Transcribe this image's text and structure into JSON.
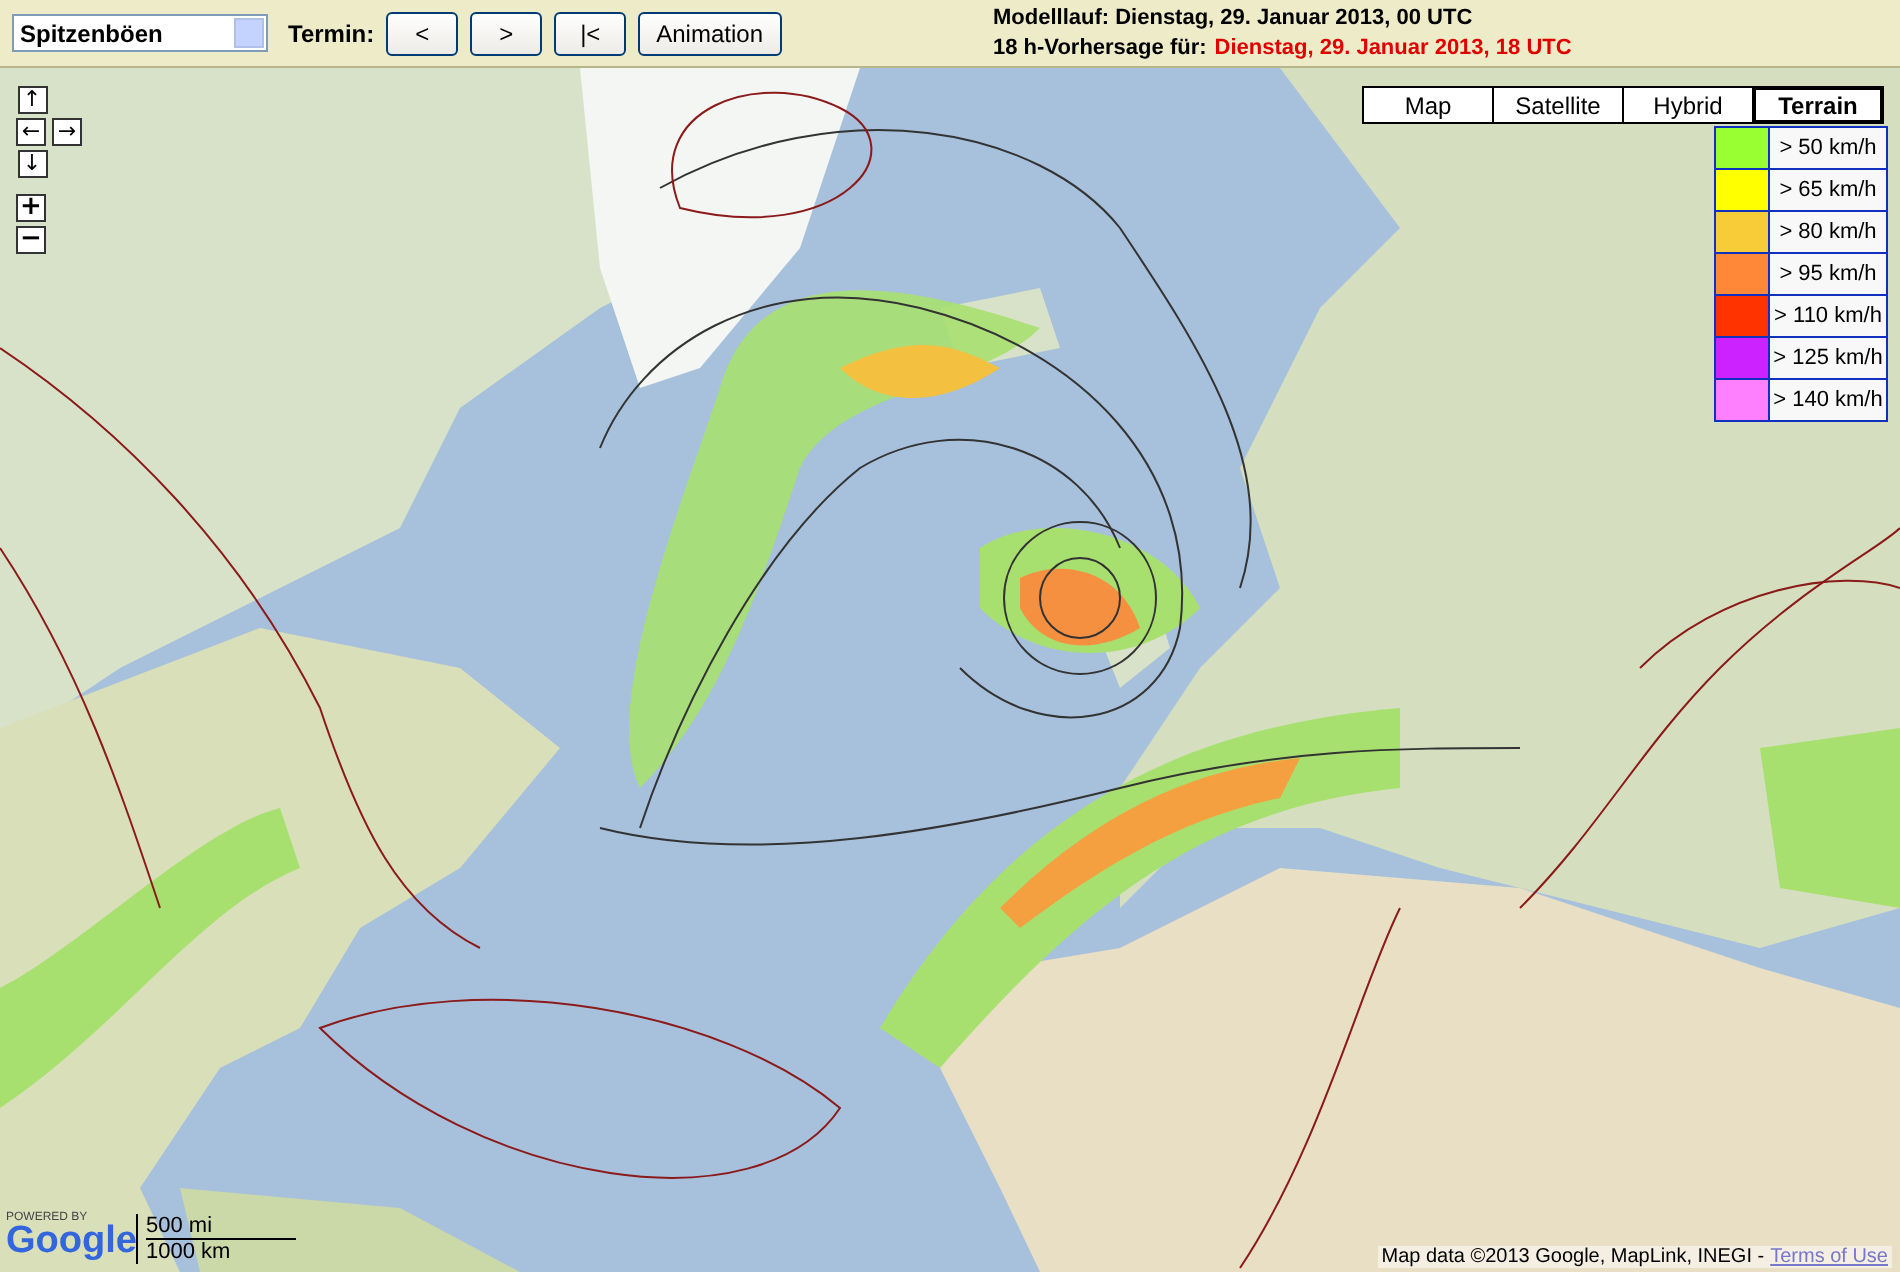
{
  "toolbar": {
    "parameter_select": {
      "value": "Spitzenböen"
    },
    "termin_label": "Termin:",
    "buttons": [
      "<",
      ">",
      "|<",
      "Animation"
    ]
  },
  "run_info": {
    "model_run": "Modelllauf: Dienstag, 29. Januar 2013, 00 UTC",
    "forecast_label": "18 h-Vorhersage für:",
    "forecast_time": "Dienstag, 29. Januar 2013, 18 UTC"
  },
  "map": {
    "nav_controls": [
      {
        "kind": "pan",
        "label": "↑"
      },
      {
        "kind": "pan",
        "label": "←"
      },
      {
        "kind": "pan",
        "label": "→"
      },
      {
        "kind": "pan",
        "label": "↓"
      },
      {
        "kind": "zoom",
        "label": "+"
      },
      {
        "kind": "zoom",
        "label": "−"
      }
    ],
    "map_types": [
      {
        "label": "Map",
        "selected": false
      },
      {
        "label": "Satellite",
        "selected": false
      },
      {
        "label": "Hybrid",
        "selected": false
      },
      {
        "label": "Terrain",
        "selected": true
      }
    ],
    "legend": [
      {
        "label": "> 50 km/h",
        "color": "#99ff33"
      },
      {
        "label": "> 65 km/h",
        "color": "#ffff00"
      },
      {
        "label": "> 80 km/h",
        "color": "#f8cc38"
      },
      {
        "label": "> 95 km/h",
        "color": "#ff8838"
      },
      {
        "label": "> 110 km/h",
        "color": "#ff3300"
      },
      {
        "label": "> 125 km/h",
        "color": "#cc22ff"
      },
      {
        "label": "> 140 km/h",
        "color": "#ff80ff"
      }
    ],
    "scale": [
      "500 mi",
      "1000 km"
    ],
    "logo": {
      "powered_by": "POWERED BY",
      "brand": "Google"
    },
    "attribution": {
      "text": "Map data ©2013 Google, MapLink, INEGI -",
      "link": "Terms of Use"
    }
  }
}
